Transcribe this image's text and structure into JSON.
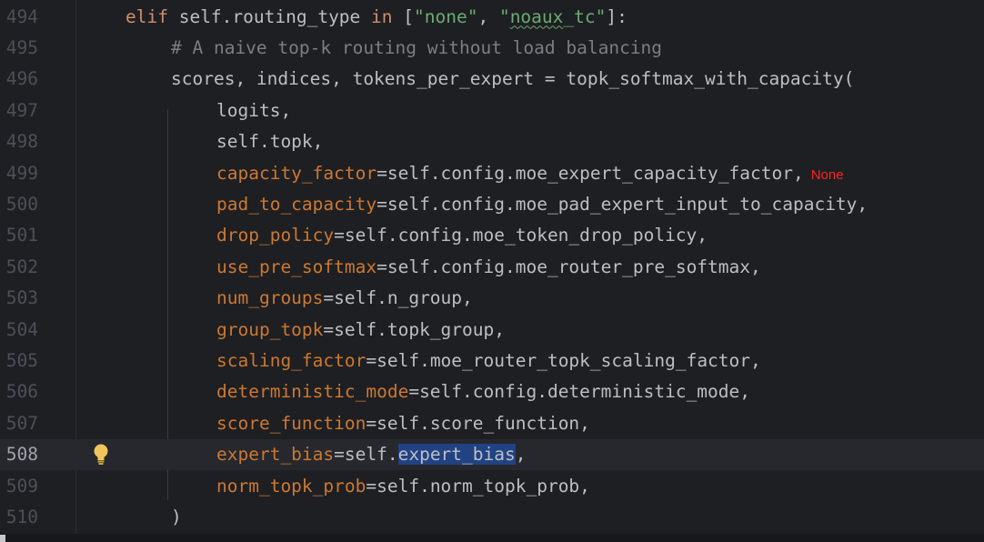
{
  "editor": {
    "current_line": "508",
    "inlay_hint": "None",
    "lines": [
      {
        "num": "494",
        "parts": [
          {
            "t": "elif",
            "c": "kw"
          },
          {
            "t": " self.routing_type "
          },
          {
            "t": "in",
            "c": "kw"
          },
          {
            "t": " ["
          },
          {
            "t": "\"none\"",
            "c": "str"
          },
          {
            "t": ", "
          },
          {
            "t": "\"",
            "c": "str"
          },
          {
            "t": "noaux",
            "c": "str typo"
          },
          {
            "t": "_tc\"",
            "c": "str"
          },
          {
            "t": "]:"
          }
        ]
      },
      {
        "num": "495",
        "parts": [
          {
            "t": "# A naive top-k routing without load balancing",
            "c": "cmt"
          }
        ]
      },
      {
        "num": "496",
        "parts": [
          {
            "t": "scores, indices, tokens_per_expert = topk_softmax_with_capacity("
          }
        ]
      },
      {
        "num": "497",
        "parts": [
          {
            "t": "logits,"
          }
        ]
      },
      {
        "num": "498",
        "parts": [
          {
            "t": "self.topk,"
          }
        ]
      },
      {
        "num": "499",
        "parts": [
          {
            "t": "capacity_factor",
            "c": "param"
          },
          {
            "t": "=self.config.moe_expert_capacity_factor,"
          }
        ],
        "inlay": true
      },
      {
        "num": "500",
        "parts": [
          {
            "t": "pad_to_capacity",
            "c": "param"
          },
          {
            "t": "=self.config.moe_pad_expert_input_to_capacity,"
          }
        ]
      },
      {
        "num": "501",
        "parts": [
          {
            "t": "drop_policy",
            "c": "param"
          },
          {
            "t": "=self.config.moe_token_drop_policy,"
          }
        ]
      },
      {
        "num": "502",
        "parts": [
          {
            "t": "use_pre_softmax",
            "c": "param"
          },
          {
            "t": "=self.config.moe_router_pre_softmax,"
          }
        ]
      },
      {
        "num": "503",
        "parts": [
          {
            "t": "num_groups",
            "c": "param"
          },
          {
            "t": "=self.n_group,"
          }
        ]
      },
      {
        "num": "504",
        "parts": [
          {
            "t": "group_topk",
            "c": "param"
          },
          {
            "t": "=self.topk_group,"
          }
        ]
      },
      {
        "num": "505",
        "parts": [
          {
            "t": "scaling_factor",
            "c": "param"
          },
          {
            "t": "=self.moe_router_topk_scaling_factor,"
          }
        ]
      },
      {
        "num": "506",
        "parts": [
          {
            "t": "deterministic_mode",
            "c": "param"
          },
          {
            "t": "=self.config.deterministic_mode,"
          }
        ]
      },
      {
        "num": "507",
        "parts": [
          {
            "t": "score_function",
            "c": "param"
          },
          {
            "t": "=self.score_function,"
          }
        ]
      },
      {
        "num": "508",
        "parts": [
          {
            "t": "expert_bias",
            "c": "param"
          },
          {
            "t": "=self."
          },
          {
            "t": "expert_bias",
            "c": "hl"
          },
          {
            "t": ","
          }
        ]
      },
      {
        "num": "509",
        "parts": [
          {
            "t": "norm_topk_prob",
            "c": "param"
          },
          {
            "t": "=self.norm_topk_prob,"
          }
        ]
      },
      {
        "num": "510",
        "parts": [
          {
            "t": ")"
          }
        ]
      }
    ]
  },
  "colors": {
    "background": "#1e1f22",
    "keyword": "#cf8e6d",
    "string": "#6aab73",
    "comment": "#7a7e85",
    "named_argument": "#cc7832",
    "selection": "#214283",
    "inlay_hint": "#ff2222"
  },
  "icons": {
    "gutter_bulb": "lightbulb-icon"
  }
}
